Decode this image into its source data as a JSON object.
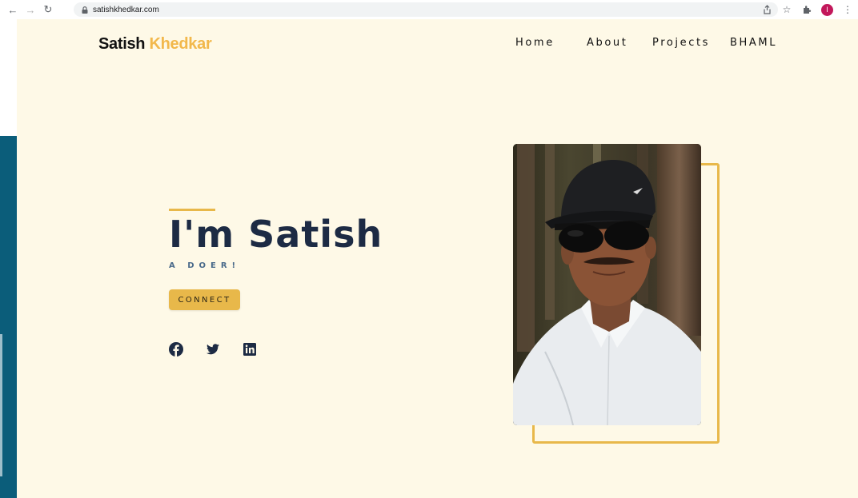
{
  "browser": {
    "url": "satishkhedkar.com",
    "profile_initial": "I"
  },
  "header": {
    "brand_first": "Satish",
    "brand_second": "Khedkar",
    "nav": [
      "Home",
      "About",
      "Projects",
      "BHAML"
    ]
  },
  "hero": {
    "title": "I'm Satish",
    "subtitle": "A DOER!",
    "connect_label": "CONNECT"
  },
  "socials": [
    "facebook-icon",
    "twitter-icon",
    "linkedin-icon"
  ],
  "colors": {
    "accent": "#e8b84a",
    "background": "#fef9e7",
    "title": "#1d2b44",
    "brand_accent": "#f2b84b"
  }
}
